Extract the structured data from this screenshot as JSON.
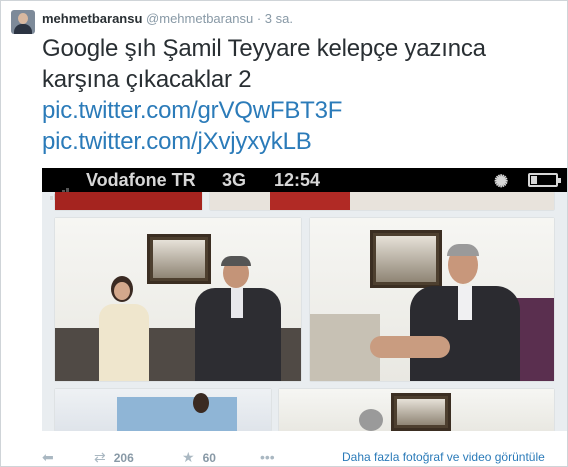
{
  "tweet": {
    "fullname": "mehmetbaransu",
    "screen_name": "@mehmetbaransu",
    "separator": "·",
    "time": "3 sa.",
    "text": "Google şıh Şamil Teyyare kelepçe yazınca karşına çıkacaklar 2",
    "links": [
      "pic.twitter.com/grVQwFBT3F",
      "pic.twitter.com/jXvjyxykLB"
    ]
  },
  "media": {
    "statusbar": {
      "carrier": "Vodafone TR",
      "network": "3G",
      "time": "12:54"
    }
  },
  "actions": {
    "reply_icon": "reply-icon",
    "retweet_icon": "retweet-icon",
    "retweet_count": "206",
    "favorite_icon": "star-icon",
    "favorite_count": "60",
    "more_icon": "ellipsis-icon",
    "view_more": "Daha fazla fotoğraf ve video görüntüle"
  },
  "colors": {
    "link": "#2b7bb9",
    "muted": "#8899a6",
    "text": "#292f33"
  }
}
